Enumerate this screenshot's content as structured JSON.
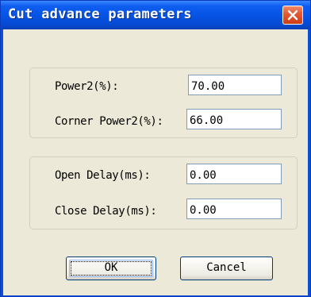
{
  "window": {
    "title": "Cut advance parameters",
    "close_icon": "close-icon"
  },
  "group_power": {
    "power2": {
      "label": "Power2(%):",
      "value": "70.00"
    },
    "corner_power2": {
      "label": "Corner Power2(%):",
      "value": "66.00"
    }
  },
  "group_delay": {
    "open_delay": {
      "label": "Open Delay(ms):",
      "value": "0.00"
    },
    "close_delay": {
      "label": "Close Delay(ms):",
      "value": "0.00"
    }
  },
  "buttons": {
    "ok_label": "OK",
    "cancel_label": "Cancel"
  },
  "colors": {
    "titlebar": "#0653e3",
    "close_button": "#e2572f",
    "dialog_background": "#ece9d8"
  }
}
